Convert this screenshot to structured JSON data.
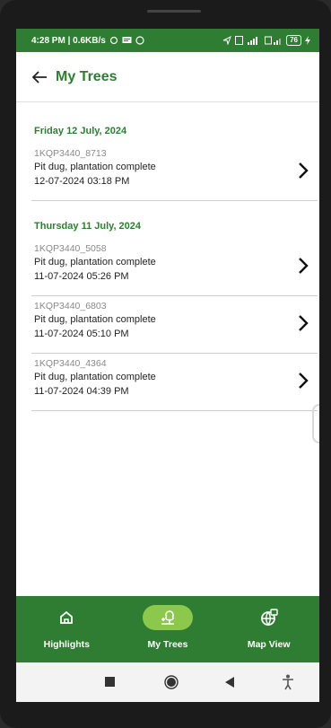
{
  "status_bar": {
    "time_net": "4:28 PM | 0.6KB/s",
    "battery": "76"
  },
  "app_bar": {
    "title": "My Trees"
  },
  "groups": [
    {
      "date": "Friday 12 July, 2024",
      "items": [
        {
          "id": "1KQP3440_8713",
          "status": "Pit dug, plantation complete",
          "time": "12-07-2024 03:18 PM"
        }
      ]
    },
    {
      "date": "Thursday 11 July, 2024",
      "items": [
        {
          "id": "1KQP3440_5058",
          "status": "Pit dug, plantation complete",
          "time": "11-07-2024 05:26 PM"
        },
        {
          "id": "1KQP3440_6803",
          "status": "Pit dug, plantation complete",
          "time": "11-07-2024 05:10 PM"
        },
        {
          "id": "1KQP3440_4364",
          "status": "Pit dug, plantation complete",
          "time": "11-07-2024 04:39 PM"
        }
      ]
    }
  ],
  "bottom_nav": {
    "items": [
      {
        "label": "Highlights",
        "icon": "home-icon"
      },
      {
        "label": "My Trees",
        "icon": "tree-icon",
        "active": true
      },
      {
        "label": "Map View",
        "icon": "globe-icon"
      }
    ]
  },
  "colors": {
    "primary": "#2f7d33",
    "active_pill": "#8cc84b"
  }
}
